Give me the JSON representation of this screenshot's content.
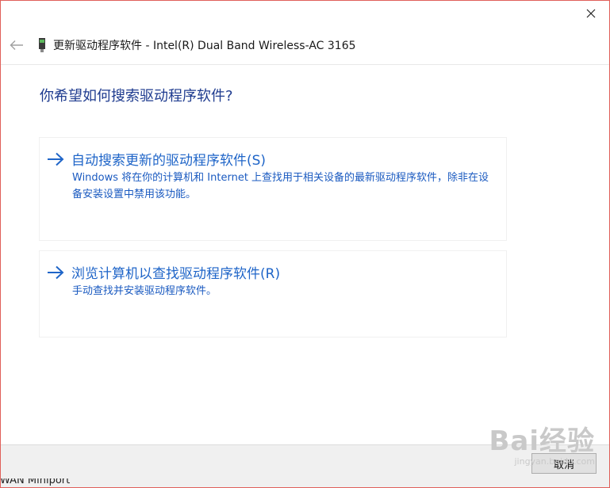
{
  "window": {
    "title": "更新驱动程序软件 - Intel(R) Dual Band Wireless-AC 3165",
    "close_glyph": "✕"
  },
  "heading": "你希望如何搜索驱动程序软件?",
  "options": [
    {
      "title": "自动搜索更新的驱动程序软件(S)",
      "description": "Windows 将在你的计算机和 Internet 上查找用于相关设备的最新驱动程序软件，除非在设备安装设置中禁用该功能。"
    },
    {
      "title": "浏览计算机以查找驱动程序软件(R)",
      "description": "手动查找并安装驱动程序软件。"
    }
  ],
  "footer": {
    "cancel_label": "取消"
  },
  "watermark": {
    "logo": "Bai经验",
    "sub": "jingyan.baidu.com"
  },
  "background_strip": {
    "text": "WAN Miniport"
  },
  "colors": {
    "heading": "#1e3b8f",
    "link": "#1f65c8",
    "window_border": "#e0605a"
  },
  "icons": {
    "back": "back-arrow-icon",
    "device": "network-adapter-icon",
    "option_arrow": "right-arrow-icon",
    "close": "close-icon"
  }
}
